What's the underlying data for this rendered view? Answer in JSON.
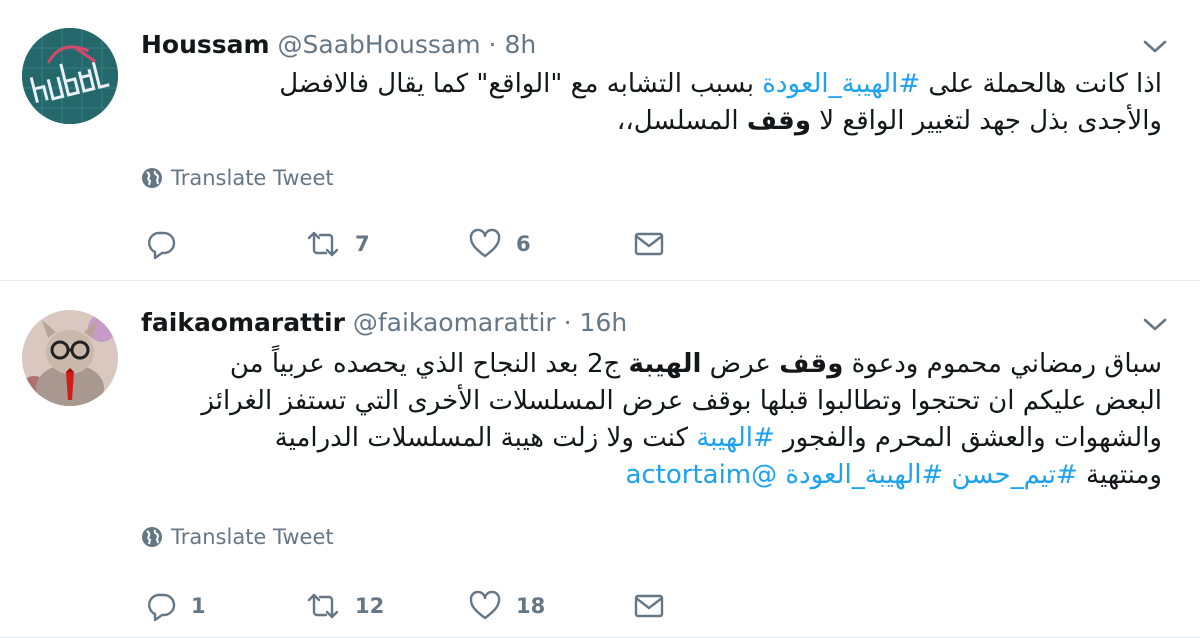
{
  "tweets": [
    {
      "name": "Houssam",
      "handle": "@SaabHoussam",
      "separator": "·",
      "time": "8h",
      "text_line1_pre": "اذا كانت هالحملة على ",
      "text_line1_hashtag": "#الهيبة_العودة",
      "text_line1_post": " بسبب التشابه مع \"الواقع\" كما يقال فالافضل",
      "text_line2_pre": "والأجدى بذل جهد لتغيير الواقع لا ",
      "text_line2_bold": "وقف",
      "text_line2_post": " المسلسل،،",
      "translate_label": "Translate Tweet",
      "reply_count": "",
      "retweet_count": "7",
      "like_count": "6"
    },
    {
      "name": "faikaomarattir",
      "handle": "@faikaomarattir",
      "separator": "·",
      "time": "16h",
      "line1_pre": "سباق رمضاني محموم ودعوة ",
      "line1_bold1": "وقف",
      "line1_mid": " عرض ",
      "line1_bold2": "الهيبة",
      "line1_post": " ج2 بعد النجاح الذي يحصده عربياً من",
      "line2": "البعض عليكم ان تحتجوا وتطالبوا قبلها بوقف عرض المسلسلات الأخرى التي تستفز الغرائز",
      "line3_pre": "والشهوات والعشق المحرم والفجور ",
      "line3_hashtag": "#الهيبة",
      "line3_post": " كنت ولا زلت هيبة المسلسلات الدرامية",
      "line4_pre": "ومنتهية ",
      "line4_hashtag1": "#تيم_حسن",
      "line4_hashtag2": "#الهيبة_العودة",
      "line4_mention": "@actortaim",
      "translate_label": "Translate Tweet",
      "reply_count": "1",
      "retweet_count": "12",
      "like_count": "18"
    }
  ],
  "icons": [
    "chevron-down-icon",
    "globe-icon",
    "reply-icon",
    "retweet-icon",
    "like-icon",
    "message-icon"
  ],
  "colors": {
    "link": "#1da1f2",
    "secondary": "#657786",
    "text": "#14171a",
    "divider": "#e6ecf0"
  }
}
